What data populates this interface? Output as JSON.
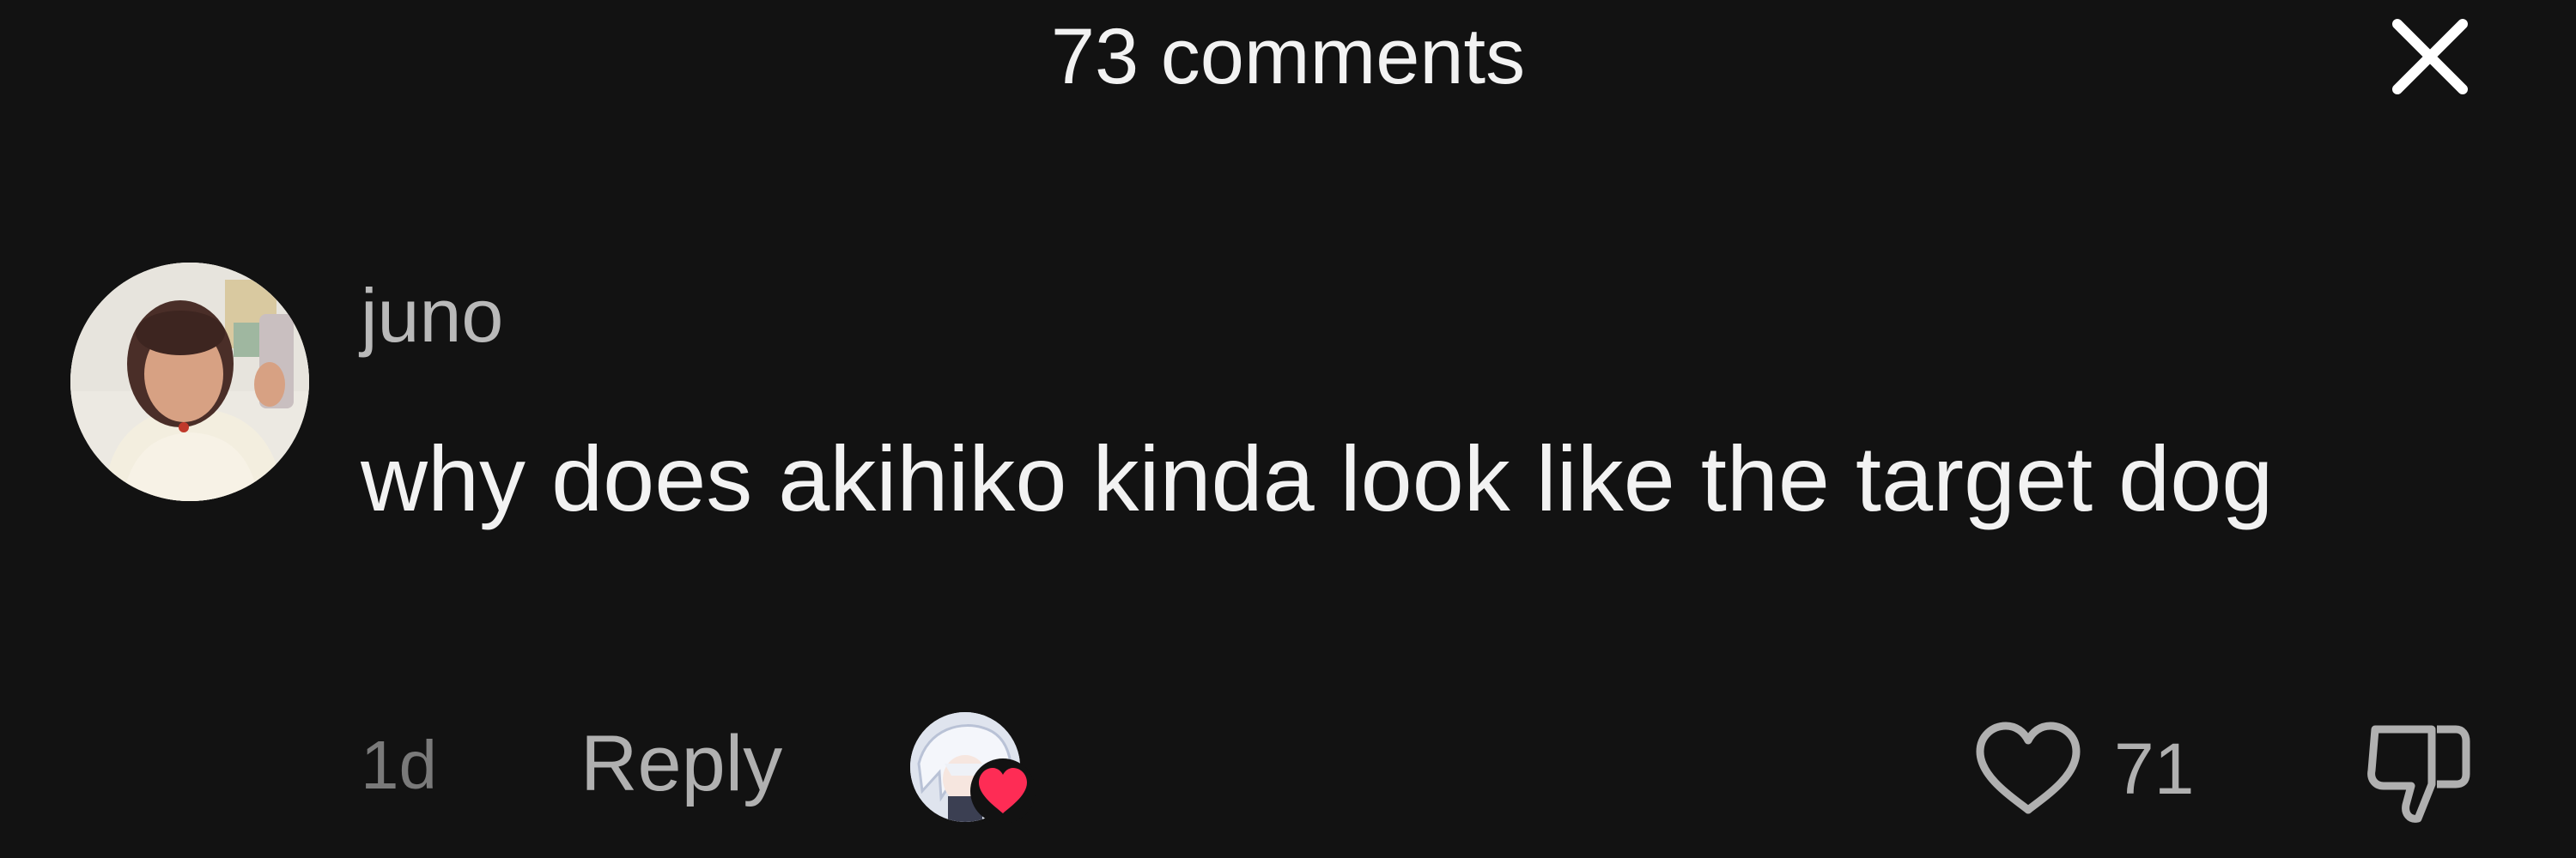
{
  "header": {
    "title": "73 comments",
    "close_icon": "close-icon"
  },
  "comment": {
    "username": "juno",
    "text": "why does akihiko kinda look like the target dog",
    "timestamp": "1d",
    "reply_label": "Reply",
    "like_count": "71",
    "icons": {
      "avatar": "user-avatar",
      "creator_like": "creator-avatar-icon",
      "heart_badge": "heart-icon",
      "like": "heart-outline-icon",
      "dislike": "thumbs-down-icon"
    }
  },
  "colors": {
    "background": "#121212",
    "primary_text": "#f2f2f2",
    "secondary_text": "#b0b0b0",
    "heart_red": "#fe2c55"
  }
}
